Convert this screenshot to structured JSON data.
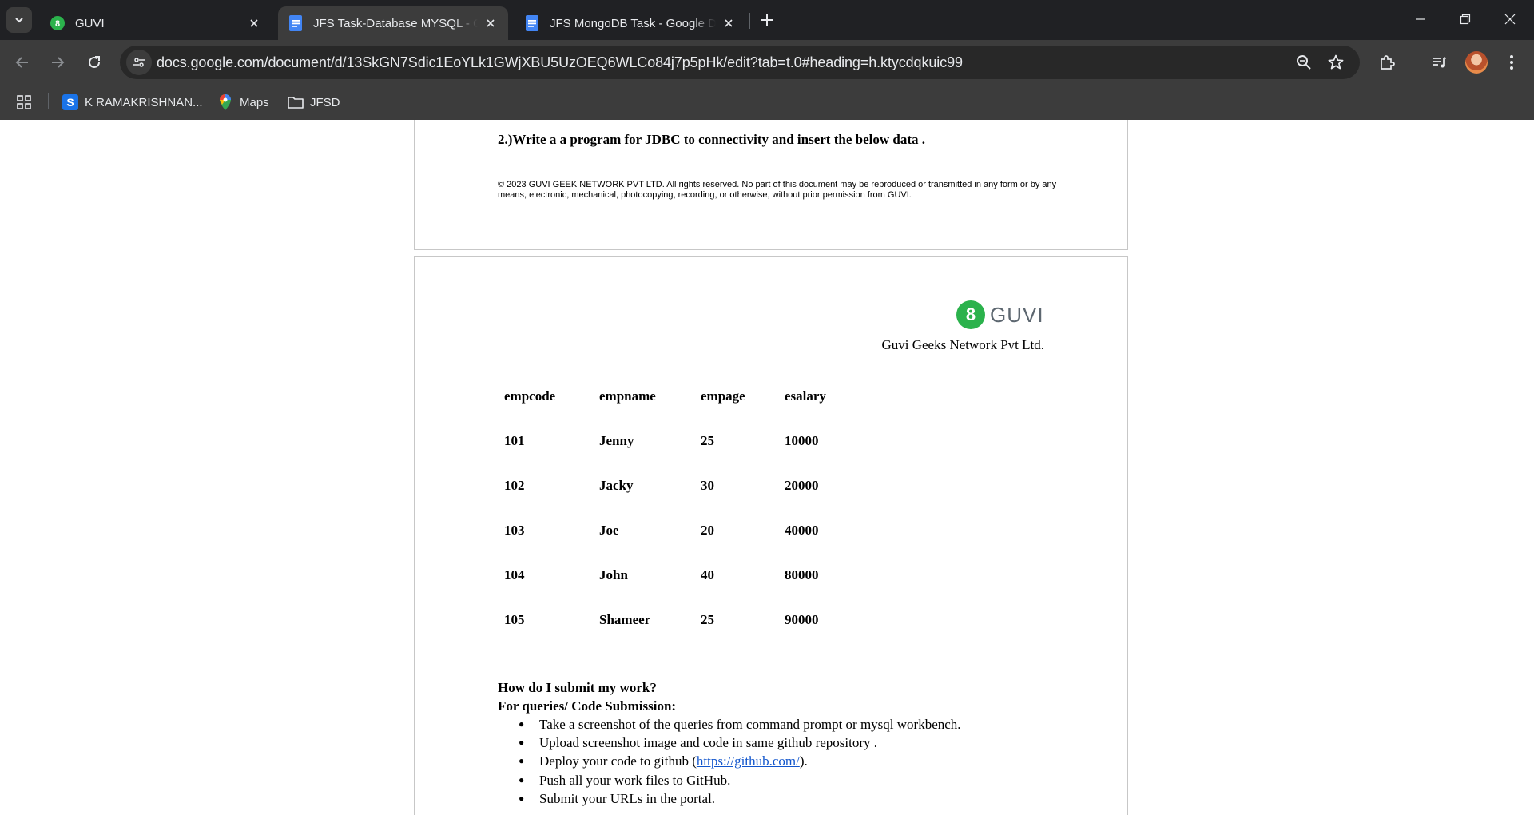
{
  "browser": {
    "tabs": [
      {
        "title": "GUVI",
        "active": false,
        "favicon": "guvi-favicon-icon"
      },
      {
        "title": "JFS Task-Database MYSQL - Google Docs",
        "active": true,
        "favicon": "google-docs-icon"
      },
      {
        "title": "JFS MongoDB Task - Google Docs",
        "active": false,
        "favicon": "google-docs-icon"
      }
    ],
    "url": {
      "domain": "docs.google.com",
      "path": "/document/d/13SkGN7Sdic1EoYLk1GWjXBU5UzOEQ6WLCo84j7p5pHk/edit?tab=t.0#heading=h.ktycdqkuic99"
    },
    "bookmarks": [
      {
        "label": "K RAMAKRISHNAN...",
        "icon": "s-badge-icon"
      },
      {
        "label": "Maps",
        "icon": "maps-pin-icon"
      },
      {
        "label": "JFSD",
        "icon": "folder-icon"
      }
    ],
    "colors": {
      "chrome_dark": "#202124",
      "toolbar": "#3c3c3c",
      "guvi_green": "#2bb24c",
      "link": "#1155cc"
    }
  },
  "document": {
    "question2": "2.)Write a a program for JDBC to connectivity and insert the below data .",
    "copyright": "© 2023 GUVI GEEK NETWORK PVT LTD. All rights reserved. No part of this document may be reproduced or transmitted in any form or by any means, electronic, mechanical, photocopying, recording, or otherwise, without prior permission from GUVI.",
    "logo_text": "GUVI",
    "company": "Guvi Geeks Network Pvt Ltd.",
    "table": {
      "headers": [
        "empcode",
        "empname",
        "empage",
        "esalary"
      ],
      "rows": [
        [
          "101",
          "Jenny",
          "25",
          "10000"
        ],
        [
          "102",
          "Jacky",
          "30",
          "20000"
        ],
        [
          "103",
          "Joe",
          "20",
          "40000"
        ],
        [
          "104",
          "John",
          "40",
          "80000"
        ],
        [
          "105",
          "Shameer",
          "25",
          "90000"
        ]
      ]
    },
    "submit_heading": "How do I submit my work?",
    "submit_subheading": "For  queries/ Code Submission:",
    "steps": {
      "s1": "Take a screenshot of the queries from command prompt or mysql workbench.",
      "s2": "Upload screenshot  image and code in same github repository .",
      "s3_pre": "Deploy your code to github (",
      "s3_link": "https://github.com/",
      "s3_post": ").",
      "s4": "Push all your work files to GitHub.",
      "s5": "Submit your URLs in the portal."
    }
  }
}
